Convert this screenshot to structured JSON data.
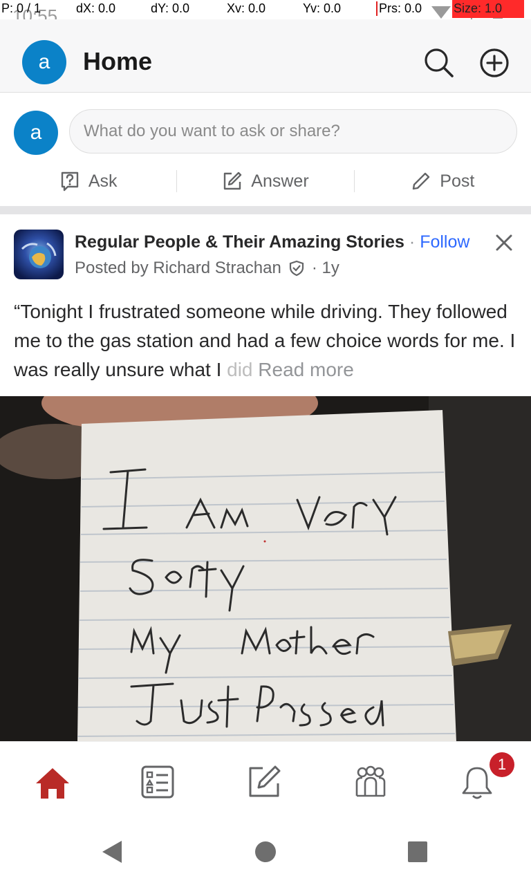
{
  "status_bar": {
    "time": "10:55",
    "debug": {
      "p": "P: 0 / 1",
      "dx": "dX: 0.0",
      "dy": "dY: 0.0",
      "xv": "Xv: 0.0",
      "yv": "Yv: 0.0",
      "prs": "Prs: 0.0",
      "size": "Size: 1.0"
    }
  },
  "header": {
    "avatar_letter": "a",
    "title": "Home",
    "icons": [
      "search-icon",
      "add-circle-icon"
    ]
  },
  "composer": {
    "avatar_letter": "a",
    "placeholder": "What do you want to ask or share?",
    "actions": [
      {
        "label": "Ask",
        "icon": "question-icon"
      },
      {
        "label": "Answer",
        "icon": "edit-icon"
      },
      {
        "label": "Post",
        "icon": "pencil-icon"
      }
    ]
  },
  "post": {
    "space_name": "Regular People & Their Amazing Stories",
    "separator": "·",
    "follow_label": "Follow",
    "posted_by": "Posted by Richard Strachan",
    "age": "· 1y",
    "text_main": "“Tonight I frustrated someone while driving. They followed me to the gas station and had a few choice words for me. I was really unsure what I",
    "text_faded": " did",
    "read_more": "Read more"
  },
  "tab_bar": {
    "tabs": [
      "home-icon",
      "list-icon",
      "answer-icon",
      "spaces-icon",
      "notifications-icon"
    ],
    "notification_count": "1",
    "active_color": "#b92b27"
  },
  "colors": {
    "accent": "#2e69ff",
    "avatar": "#0b82c8",
    "brand": "#b92b27"
  }
}
